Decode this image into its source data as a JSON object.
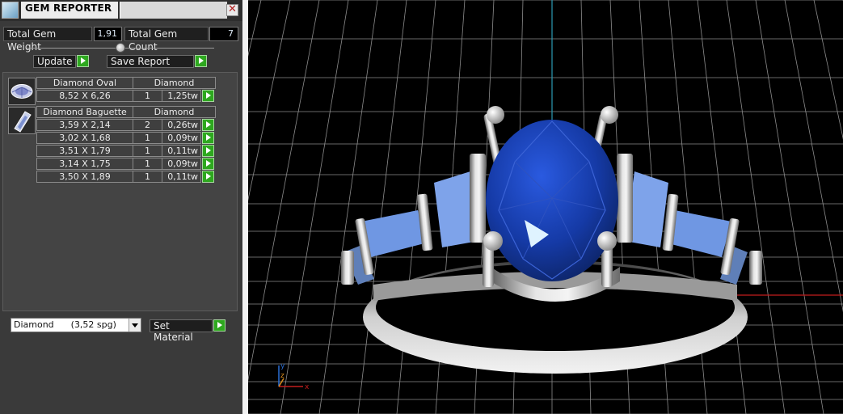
{
  "window": {
    "title": "GEM REPORTER",
    "close_symbol": "✕"
  },
  "totals": {
    "weight_label": "Total Gem Weight",
    "weight_value": "1,91",
    "count_label": "Total Gem Count",
    "count_value": "7"
  },
  "buttons": {
    "update_label": "Update",
    "save_report_label": "Save Report",
    "set_material_label": "Set Material"
  },
  "gem_groups": [
    {
      "icon": "oval-gem-icon",
      "name": "Diamond Oval",
      "material": "Diamond",
      "rows": [
        {
          "size": "8,52 X 6,26",
          "qty": "1",
          "weight": "1,25tw"
        }
      ]
    },
    {
      "icon": "baguette-gem-icon",
      "name": "Diamond Baguette",
      "material": "Diamond",
      "rows": [
        {
          "size": "3,59 X 2,14",
          "qty": "2",
          "weight": "0,26tw"
        },
        {
          "size": "3,02 X 1,68",
          "qty": "1",
          "weight": "0,09tw"
        },
        {
          "size": "3,51 X 1,79",
          "qty": "1",
          "weight": "0,11tw"
        },
        {
          "size": "3,14 X 1,75",
          "qty": "1",
          "weight": "0,09tw"
        },
        {
          "size": "3,50 X 1,89",
          "qty": "1",
          "weight": "0,11tw"
        }
      ]
    }
  ],
  "material": {
    "selected": "Diamond      (3,52 spg)"
  },
  "viewport": {
    "axis_labels": {
      "x": "x",
      "y": "y",
      "z": "z"
    },
    "colors": {
      "grid": "#8c8c8c",
      "x_axis": "#c21d1d",
      "y_axis": "#2b9bb4",
      "gem_blue": "#1a3fb8",
      "baguette_blue": "#6f97e3",
      "metal": "#d8d8d8"
    }
  }
}
